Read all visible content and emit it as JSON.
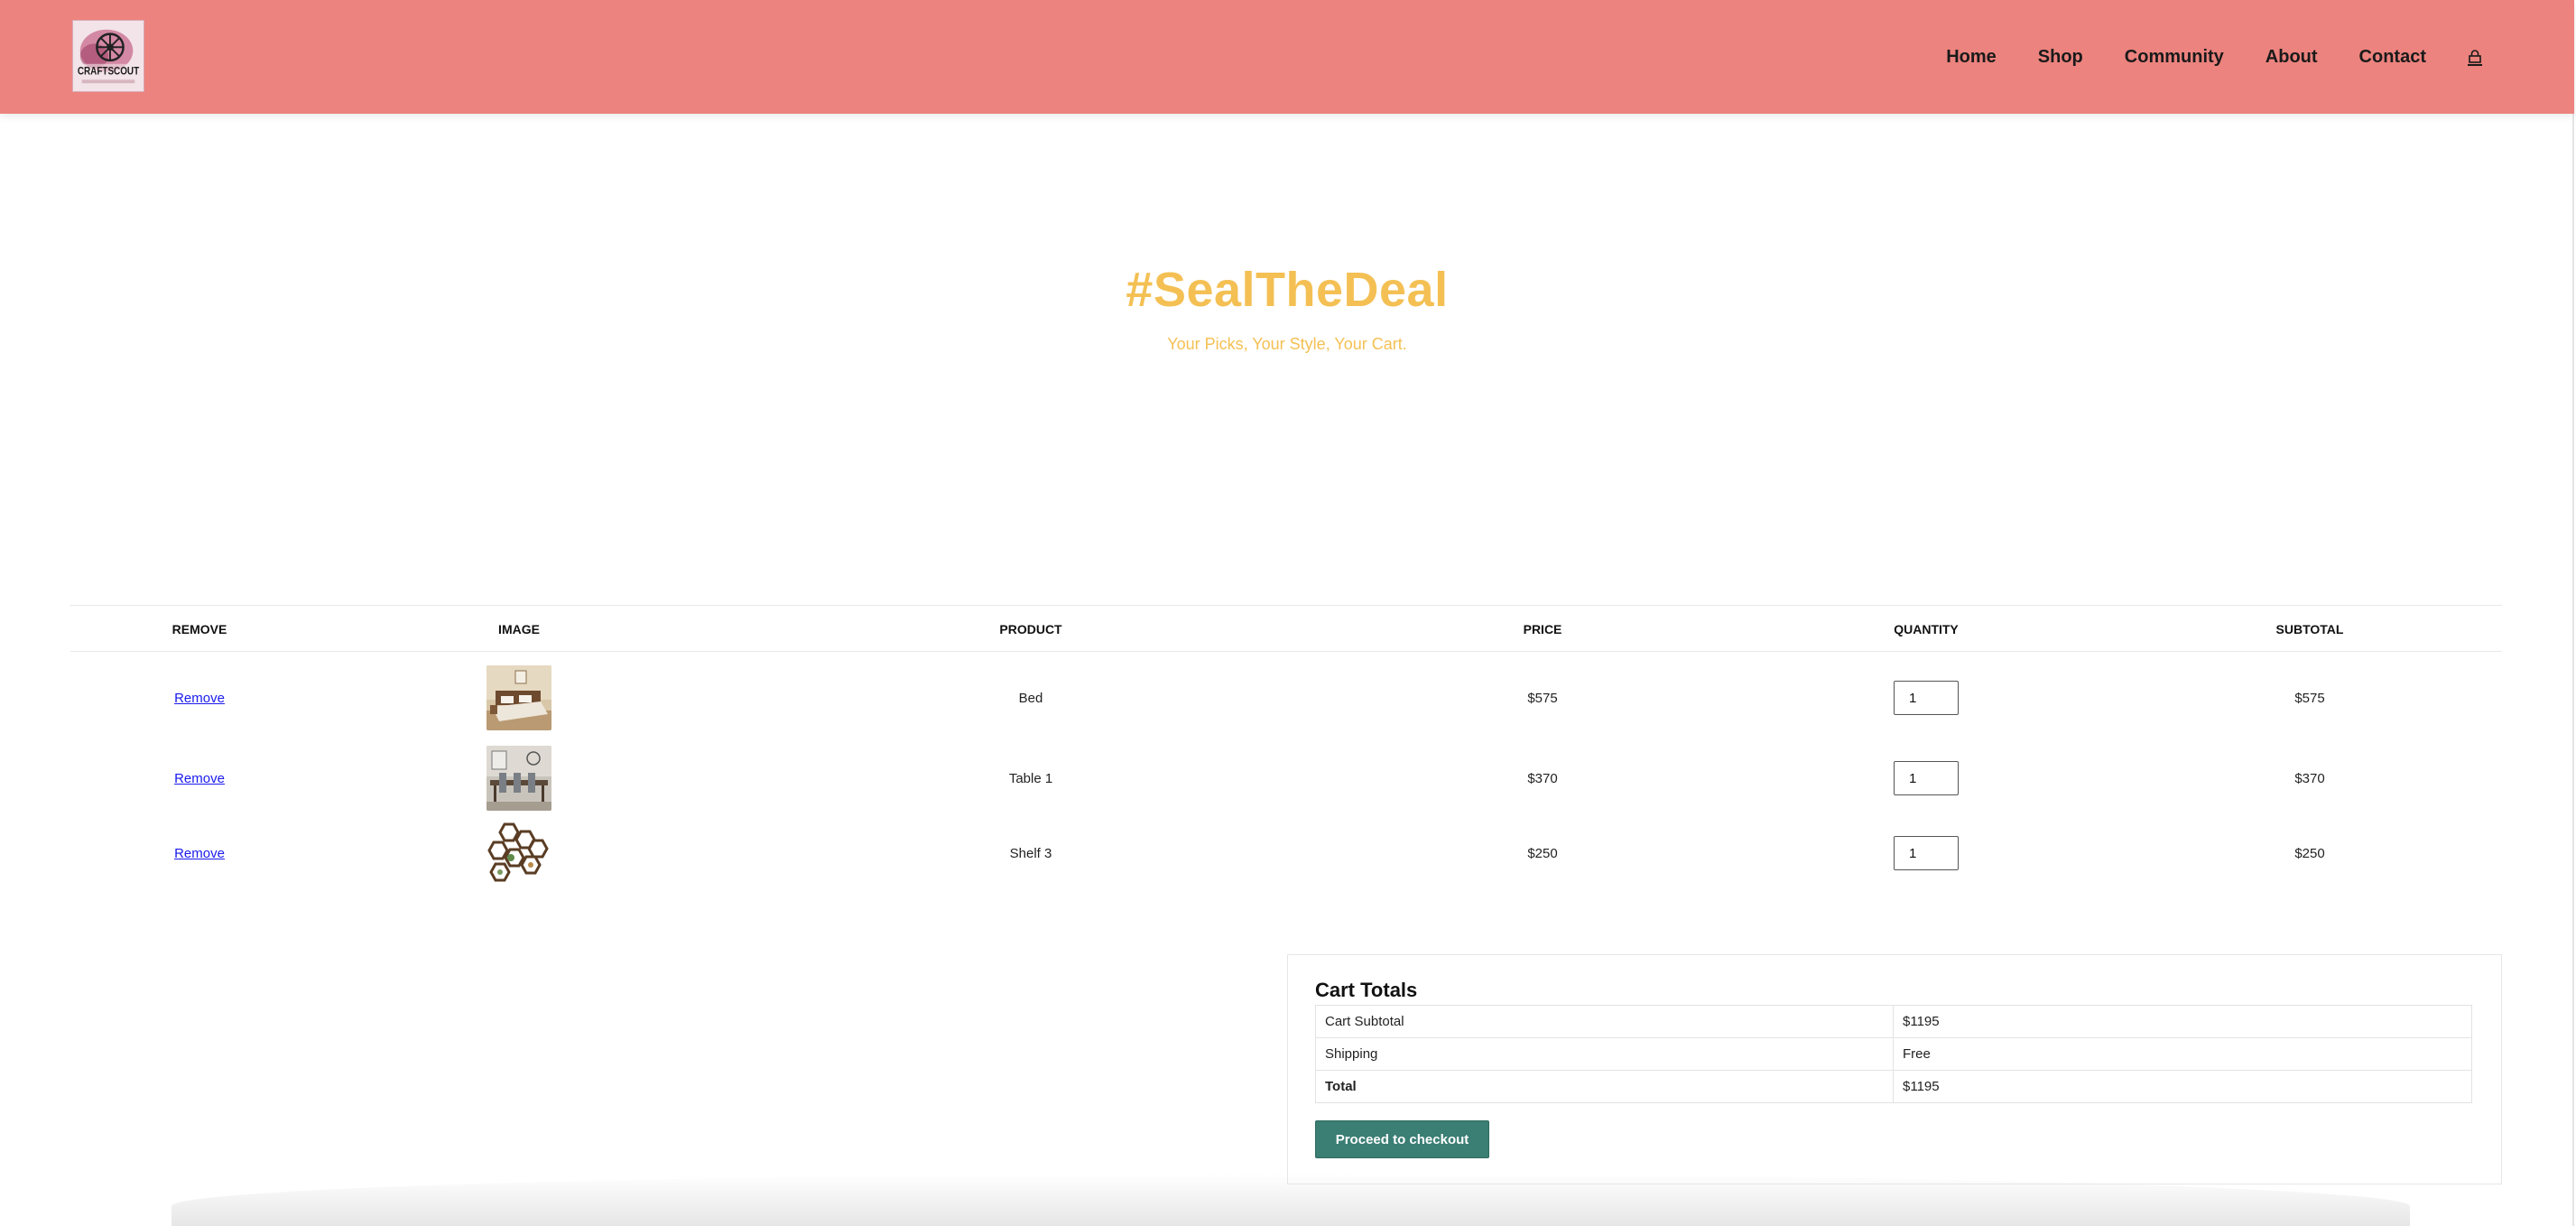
{
  "nav": {
    "items": [
      "Home",
      "Shop",
      "Community",
      "About",
      "Contact"
    ],
    "cart_icon": "shopping-bag-icon"
  },
  "logo": {
    "text": "CRAFTSCOUT"
  },
  "hero": {
    "title": "#SealTheDeal",
    "subtitle": "Your Picks, Your Style, Your Cart."
  },
  "cart": {
    "headers": {
      "remove": "REMOVE",
      "image": "IMAGE",
      "product": "PRODUCT",
      "price": "PRICE",
      "quantity": "QUANTITY",
      "subtotal": "SUBTOTAL"
    },
    "rows": [
      {
        "remove_label": "Remove",
        "image": "bed-photo",
        "product": "Bed",
        "price": "$575",
        "quantity": "1",
        "subtotal": "$575"
      },
      {
        "remove_label": "Remove",
        "image": "dining-table-photo",
        "product": "Table 1",
        "price": "$370",
        "quantity": "1",
        "subtotal": "$370"
      },
      {
        "remove_label": "Remove",
        "image": "hexagon-shelf-photo",
        "product": "Shelf 3",
        "price": "$250",
        "quantity": "1",
        "subtotal": "$250"
      }
    ]
  },
  "totals": {
    "title": "Cart Totals",
    "rows": [
      {
        "label": "Cart Subtotal",
        "value": "$1195"
      },
      {
        "label": "Shipping",
        "value": "Free"
      },
      {
        "label": "Total",
        "value": "$1195"
      }
    ],
    "checkout_label": "Proceed to checkout"
  },
  "colors": {
    "header_bg": "#ec837e",
    "hero_text": "#f4c054",
    "checkout_button": "#3a7e74",
    "link": "#1a1aee"
  }
}
